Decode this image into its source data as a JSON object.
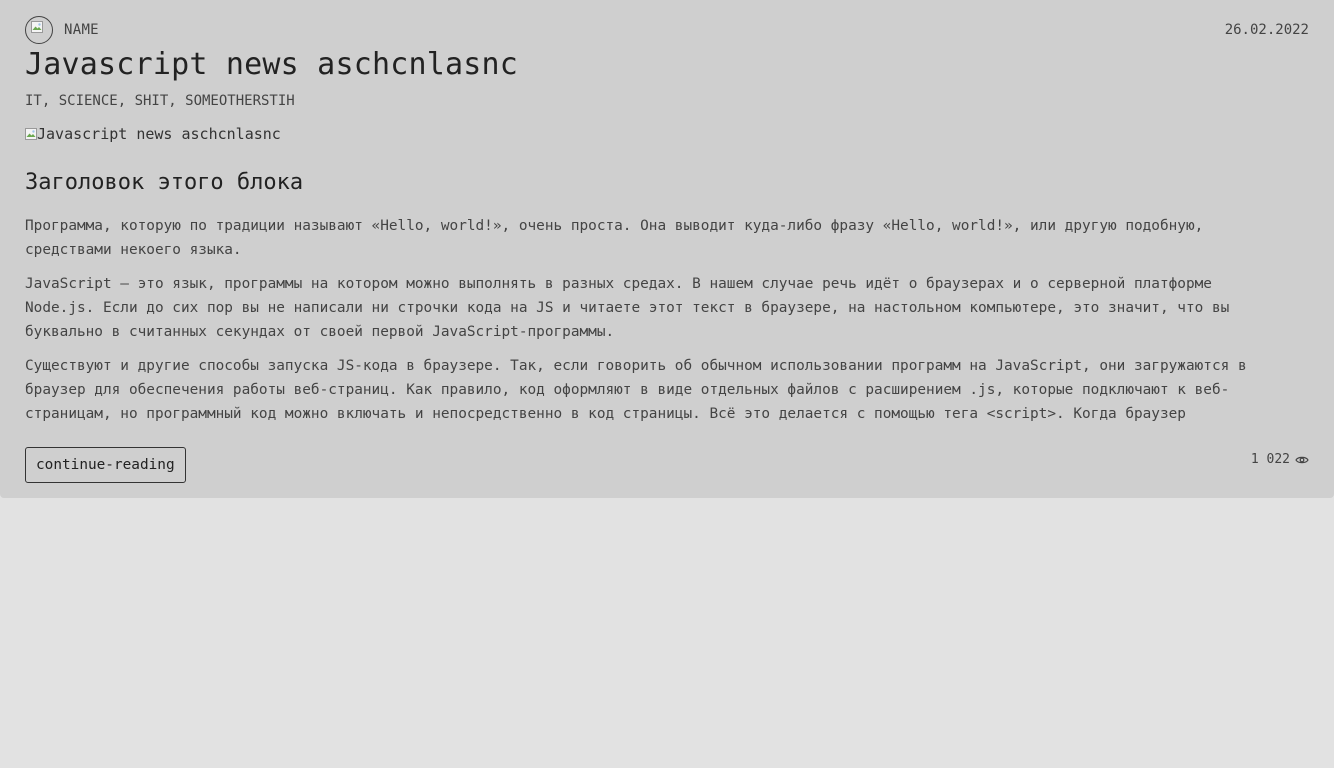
{
  "post": {
    "author_name": "NAME",
    "avatar_alt": "",
    "date": "26.02.2022",
    "title": "Javascript news aschcnlasnc",
    "tags": "IT, SCIENCE, SHIT, SOMEOTHERSTIH",
    "cover_alt": "Javascript news aschcnlasnc",
    "block_title": "Заголовок этого блока",
    "paragraphs": [
      "Программа, которую по традиции называют «Hello, world!», очень проста. Она выводит куда-либо фразу «Hello, world!», или другую подобную, средствами некоего языка.",
      "JavaScript — это язык, программы на котором можно выполнять в разных средах. В нашем случае речь идёт о браузерах и о серверной платформе Node.js. Если до сих пор вы не написали ни строчки кода на JS и читаете этот текст в браузере, на настольном компьютере, это значит, что вы буквально в считанных секундах от своей первой JavaScript-программы.",
      "Существуют и другие способы запуска JS-кода в браузере. Так, если говорить об обычном использовании программ на JavaScript, они загружаются в браузер для обеспечения работы веб-страниц. Как правило, код оформляют в виде отдельных файлов с расширением .js, которые подключают к веб-страницам, но программный код можно включать и непосредственно в код страницы. Всё это делается с помощью тега <script>. Когда браузер"
    ],
    "continue_label": "continue-reading",
    "views_count": "1 022",
    "views_icon": "eye-icon"
  },
  "colors": {
    "page_bg": "#e2e2e2",
    "card_bg": "#cfcfcf",
    "text": "#444444"
  }
}
